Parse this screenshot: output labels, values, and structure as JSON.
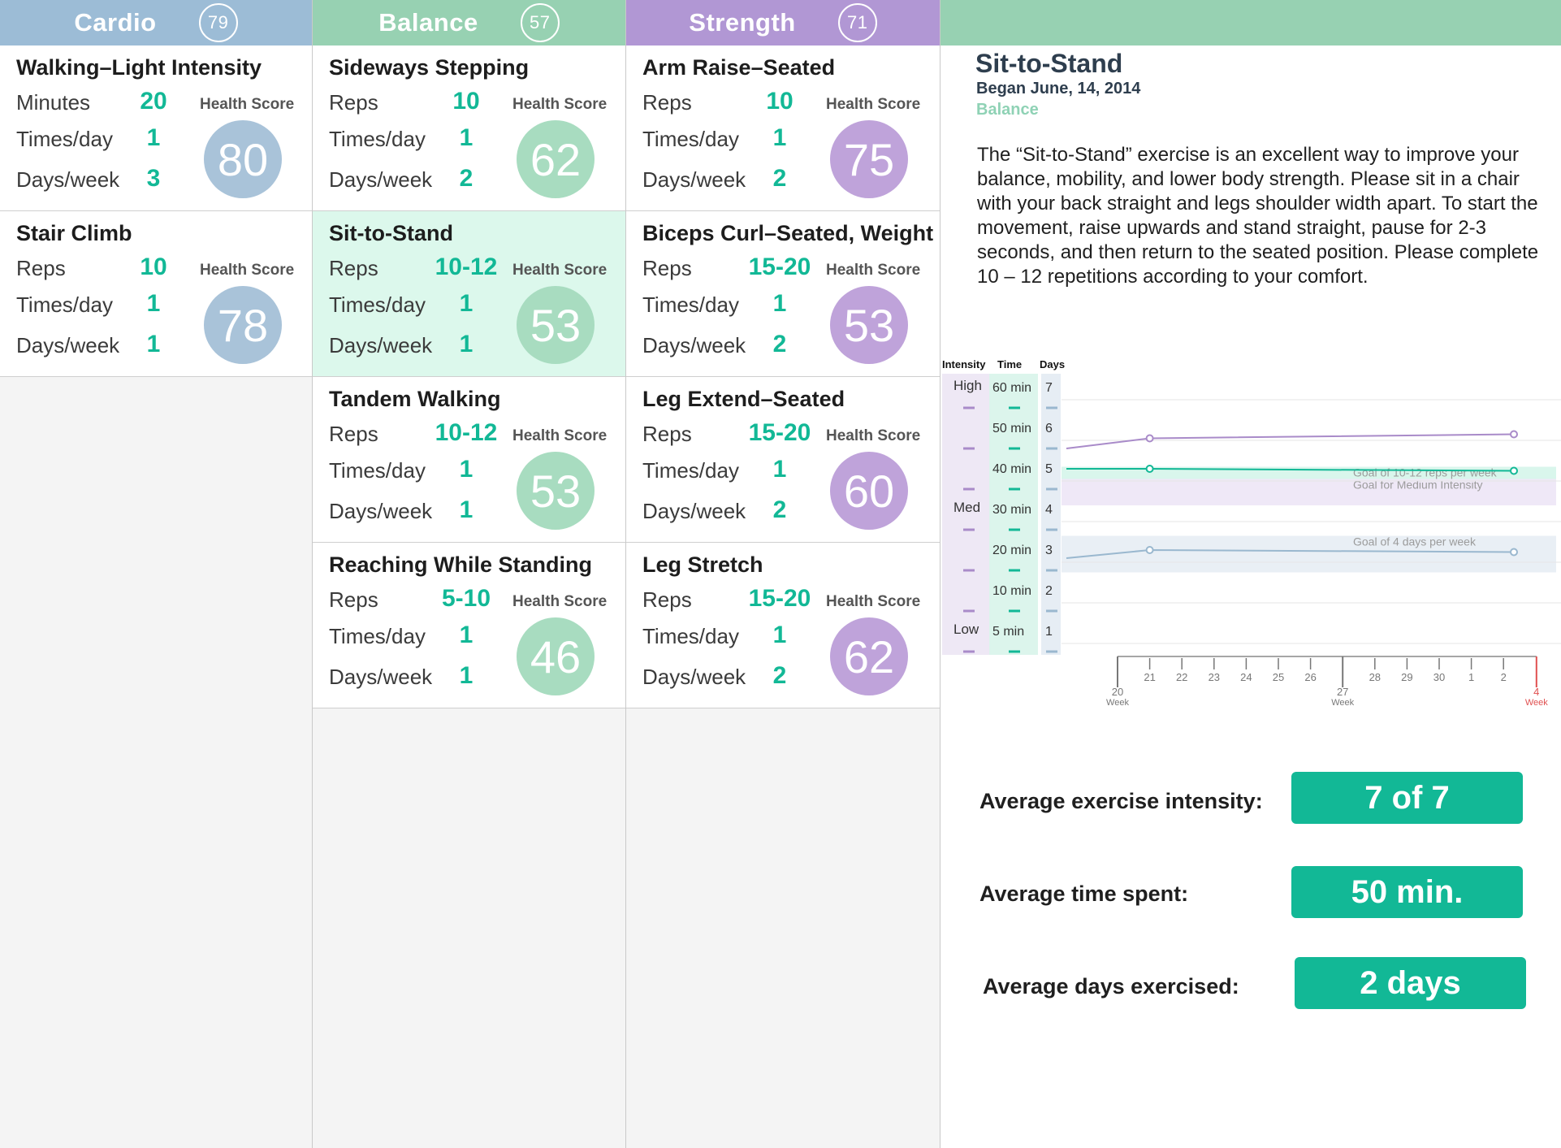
{
  "columns": [
    {
      "name": "Cardio",
      "count": "79",
      "header_color": "#9cbcd6",
      "score_color": "#a9c3d9",
      "cards": [
        {
          "title": "Walking–Light Intensity",
          "rows": [
            {
              "label": "Minutes",
              "value": "20"
            },
            {
              "label": "Times/day",
              "value": "1"
            },
            {
              "label": "Days/week",
              "value": "3"
            }
          ],
          "health_label": "Health Score",
          "score": "80"
        },
        {
          "title": "Stair Climb",
          "rows": [
            {
              "label": "Reps",
              "value": "10"
            },
            {
              "label": "Times/day",
              "value": "1"
            },
            {
              "label": "Days/week",
              "value": "1"
            }
          ],
          "health_label": "Health Score",
          "score": "78"
        }
      ]
    },
    {
      "name": "Balance",
      "count": "57",
      "header_color": "#97d1b2",
      "score_color": "#a8dcc0",
      "cards": [
        {
          "title": "Sideways Stepping",
          "rows": [
            {
              "label": "Reps",
              "value": "10"
            },
            {
              "label": "Times/day",
              "value": "1"
            },
            {
              "label": "Days/week",
              "value": "2"
            }
          ],
          "health_label": "Health Score",
          "score": "62"
        },
        {
          "title": "Sit-to-Stand",
          "rows": [
            {
              "label": "Reps",
              "value": "10-12"
            },
            {
              "label": "Times/day",
              "value": "1"
            },
            {
              "label": "Days/week",
              "value": "1"
            }
          ],
          "health_label": "Health Score",
          "score": "53",
          "selected": true
        },
        {
          "title": "Tandem Walking",
          "rows": [
            {
              "label": "Reps",
              "value": "10-12"
            },
            {
              "label": "Times/day",
              "value": "1"
            },
            {
              "label": "Days/week",
              "value": "1"
            }
          ],
          "health_label": "Health Score",
          "score": "53"
        },
        {
          "title": "Reaching While Standing",
          "rows": [
            {
              "label": "Reps",
              "value": "5-10"
            },
            {
              "label": "Times/day",
              "value": "1"
            },
            {
              "label": "Days/week",
              "value": "1"
            }
          ],
          "health_label": "Health Score",
          "score": "46"
        }
      ]
    },
    {
      "name": "Strength",
      "count": "71",
      "header_color": "#b197d4",
      "score_color": "#bfa3da",
      "cards": [
        {
          "title": "Arm Raise–Seated",
          "rows": [
            {
              "label": "Reps",
              "value": "10"
            },
            {
              "label": "Times/day",
              "value": "1"
            },
            {
              "label": "Days/week",
              "value": "2"
            }
          ],
          "health_label": "Health Score",
          "score": "75"
        },
        {
          "title": "Biceps Curl–Seated, Weight",
          "rows": [
            {
              "label": "Reps",
              "value": "15-20"
            },
            {
              "label": "Times/day",
              "value": "1"
            },
            {
              "label": "Days/week",
              "value": "2"
            }
          ],
          "health_label": "Health Score",
          "score": "53"
        },
        {
          "title": "Leg Extend–Seated",
          "rows": [
            {
              "label": "Reps",
              "value": "15-20"
            },
            {
              "label": "Times/day",
              "value": "1"
            },
            {
              "label": "Days/week",
              "value": "2"
            }
          ],
          "health_label": "Health Score",
          "score": "60"
        },
        {
          "title": "Leg Stretch",
          "rows": [
            {
              "label": "Reps",
              "value": "15-20"
            },
            {
              "label": "Times/day",
              "value": "1"
            },
            {
              "label": "Days/week",
              "value": "2"
            }
          ],
          "health_label": "Health Score",
          "score": "62"
        }
      ]
    }
  ],
  "detail": {
    "title": "Sit-to-Stand",
    "began": "Began June, 14, 2014",
    "category": "Balance",
    "description": "The “Sit-to-Stand” exercise is an excellent way to improve your balance, mobility, and lower body strength. Please sit in a chair with your back straight and legs shoulder width apart. To start the movement, raise upwards and stand straight, pause for 2-3 seconds, and then return to the seated position. Please complete 10 – 12 repetitions according to your comfort.",
    "averages": [
      {
        "label": "Average exercise intensity:",
        "value": "7 of 7"
      },
      {
        "label": "Average time spent:",
        "value": "50 min."
      },
      {
        "label": "Average days exercised:",
        "value": "2 days"
      }
    ]
  },
  "colors": {
    "accent": "#12b896",
    "detail_header": "#97d1b2",
    "intensity_line": "#a98bc9",
    "time_line": "#12b896",
    "days_line": "#9ab8cf",
    "current_week": "#e05050"
  },
  "chart_data": {
    "type": "line",
    "column_headers": [
      "Intensity",
      "Time",
      "Days"
    ],
    "intensity_labels": [
      "High",
      "Med",
      "Low"
    ],
    "time_labels": [
      "60 min",
      "50 min",
      "40 min",
      "30 min",
      "20 min",
      "10 min",
      "5 min"
    ],
    "days_labels": [
      "7",
      "6",
      "5",
      "4",
      "3",
      "2",
      "1"
    ],
    "x_ticks": [
      "20",
      "21",
      "22",
      "23",
      "24",
      "25",
      "26",
      "27",
      "28",
      "29",
      "30",
      "1",
      "2",
      "4"
    ],
    "x_tick_labels": {
      "20": "Week",
      "27": "Week",
      "4": "Week"
    },
    "y_scale": [
      1,
      7
    ],
    "goals": [
      {
        "label": "Goal of 10-12 reps  per week",
        "range": [
          4.85,
          5.15
        ]
      },
      {
        "label": "Goal for Medium Intensity",
        "range": [
          4.2,
          4.85
        ]
      },
      {
        "label": "Goal of 4 days per week",
        "range": [
          2.55,
          3.45
        ]
      }
    ],
    "series": [
      {
        "x": [
          20,
          21,
          4
        ],
        "values": [
          5.5,
          5.75,
          5.85
        ]
      },
      {
        "x": [
          20,
          21,
          4
        ],
        "values": [
          5,
          5,
          4.95
        ]
      },
      {
        "x": [
          20,
          21,
          4
        ],
        "values": [
          2.8,
          3,
          2.95
        ]
      }
    ]
  }
}
